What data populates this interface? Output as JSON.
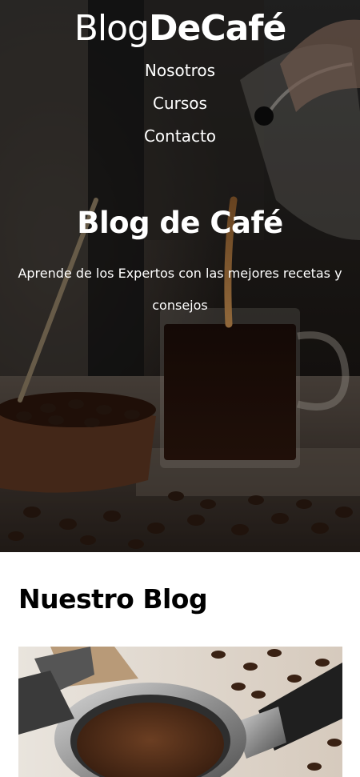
{
  "header": {
    "logo_light": "Blog",
    "logo_bold": "DeCafé"
  },
  "nav": {
    "items": [
      {
        "label": "Nosotros"
      },
      {
        "label": "Cursos"
      },
      {
        "label": "Contacto"
      }
    ]
  },
  "hero": {
    "title": "Blog de Café",
    "subtitle": "Aprende de los Expertos con las mejores recetas y consejos"
  },
  "blog": {
    "title": "Nuestro Blog"
  },
  "colors": {
    "hero_text": "#ffffff",
    "body_bg": "#ffffff",
    "heading": "#000000"
  }
}
